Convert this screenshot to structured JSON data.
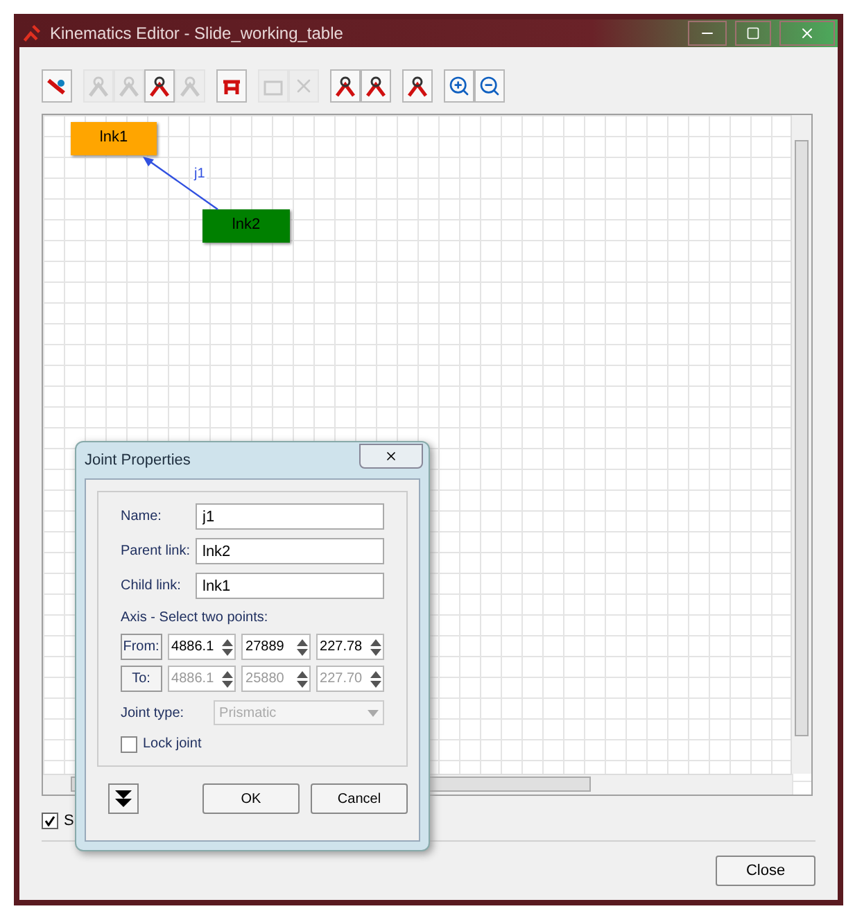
{
  "window": {
    "title": "Kinematics Editor -  Slide_working_table"
  },
  "toolbar_groups": [
    [
      {
        "kind": "link",
        "disabled": false
      }
    ],
    [
      {
        "kind": "joint",
        "disabled": true
      },
      {
        "kind": "joint",
        "disabled": true
      },
      {
        "kind": "joint",
        "disabled": false
      },
      {
        "kind": "joint",
        "disabled": true
      }
    ],
    [
      {
        "kind": "table",
        "disabled": false
      }
    ],
    [
      {
        "kind": "box",
        "disabled": true
      },
      {
        "kind": "delete",
        "disabled": true
      }
    ],
    [
      {
        "kind": "joint",
        "disabled": false
      },
      {
        "kind": "joint",
        "disabled": false
      }
    ],
    [
      {
        "kind": "joint",
        "disabled": false
      }
    ],
    [
      {
        "kind": "zoom-in",
        "disabled": false
      },
      {
        "kind": "zoom-out",
        "disabled": false
      }
    ]
  ],
  "canvas": {
    "links": [
      {
        "label": "lnk1",
        "color": "#ffa500"
      },
      {
        "label": "lnk2",
        "color": "#008000"
      }
    ],
    "joint_label": "j1"
  },
  "show_option": {
    "label": "S",
    "checked": true
  },
  "close_button": "Close",
  "dialog": {
    "title": "Joint Properties",
    "fields": [
      {
        "label": "Name:",
        "value": "j1"
      },
      {
        "label": "Parent link:",
        "value": "lnk2"
      },
      {
        "label": "Child link:",
        "value": "lnk1"
      }
    ],
    "axis_label": "Axis - Select two points:",
    "points": [
      {
        "button": "From:",
        "disabled": false,
        "values": [
          "4886.1",
          "27889",
          "227.78"
        ]
      },
      {
        "button": "To:",
        "disabled": true,
        "values": [
          "4886.1",
          "25880",
          "227.70"
        ]
      }
    ],
    "joint_type": {
      "label": "Joint type:",
      "value": "Prismatic",
      "disabled": true
    },
    "lock_joint": {
      "label": "Lock joint",
      "checked": false
    },
    "buttons": [
      "OK",
      "Cancel"
    ]
  }
}
